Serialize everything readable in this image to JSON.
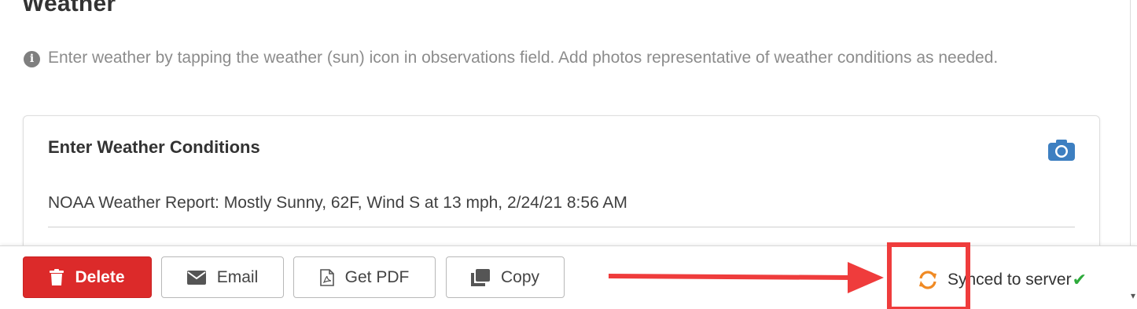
{
  "section": {
    "title": "Weather",
    "info_text": "Enter weather by tapping the weather (sun) icon in observations field. Add photos representative of weather conditions as needed."
  },
  "card": {
    "title": "Enter Weather Conditions",
    "observation": "NOAA Weather Report: Mostly Sunny, 62F, Wind S at 13 mph, 2/24/21 8:56 AM"
  },
  "toolbar": {
    "delete_label": "Delete",
    "email_label": "Email",
    "pdf_label": "Get PDF",
    "copy_label": "Copy",
    "sync_status": "Synced to server",
    "sync_check": "✔"
  },
  "icons": {
    "info": "info-icon",
    "camera": "camera-icon",
    "trash": "trash-icon",
    "envelope": "envelope-icon",
    "pdf": "pdf-file-icon",
    "copy": "copy-icon",
    "sync": "sync-icon",
    "check": "check-icon"
  },
  "colors": {
    "delete": "#dc2a2a",
    "camera": "#3d7fc1",
    "sync": "#f08a24",
    "check": "#2eaa3c",
    "annotation": "#ef3c3c"
  }
}
